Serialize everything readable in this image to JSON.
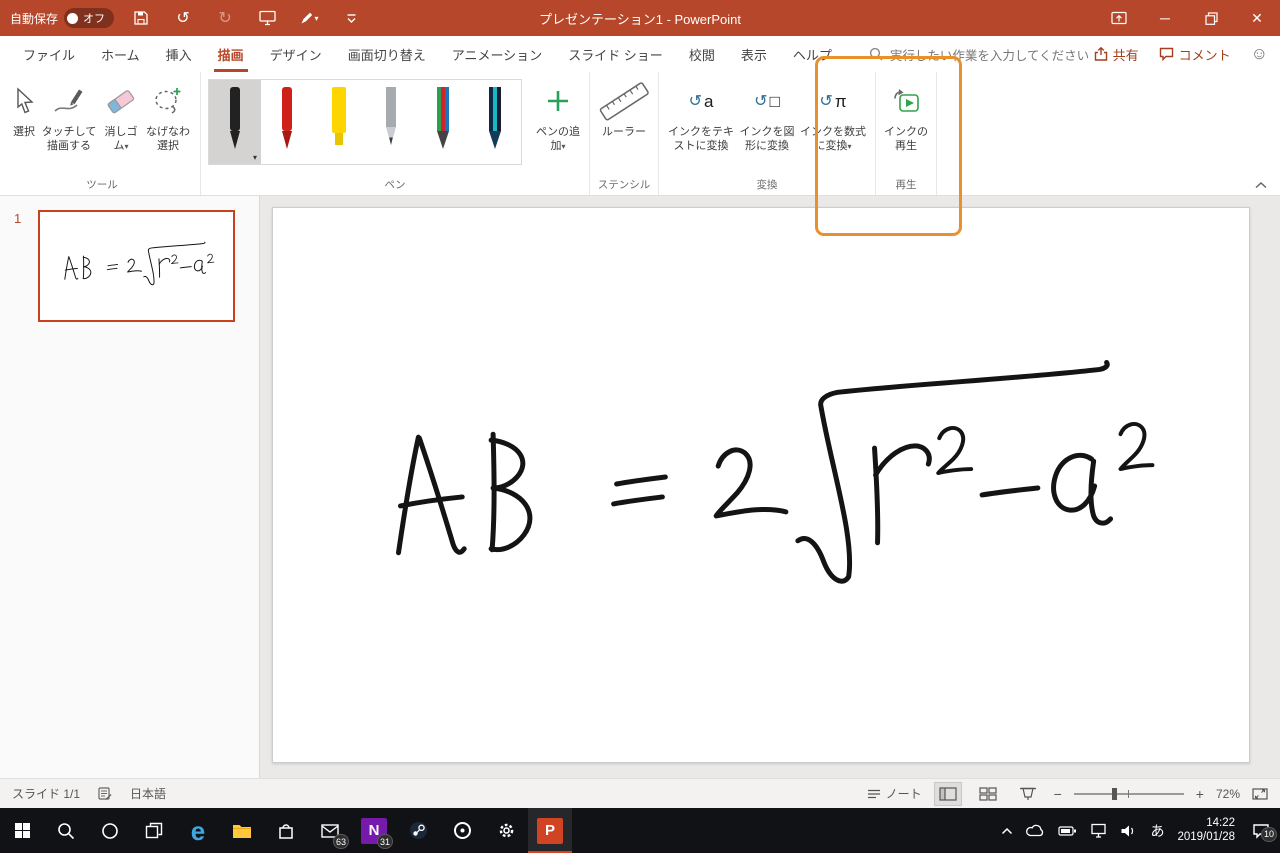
{
  "colors": {
    "accent": "#B7472A",
    "annotation_box": "#E8912C",
    "selection_border": "#C8401E",
    "powerpoint_orange": "#D04423"
  },
  "titlebar": {
    "autosave_label": "自動保存",
    "autosave_state": "オフ",
    "title": "プレゼンテーション1 - PowerPoint"
  },
  "tabs": {
    "file": "ファイル",
    "home": "ホーム",
    "insert": "挿入",
    "draw": "描画",
    "design": "デザイン",
    "transitions": "画面切り替え",
    "animations": "アニメーション",
    "slideshow": "スライド ショー",
    "review": "校閲",
    "view": "表示",
    "help": "ヘルプ"
  },
  "search": {
    "placeholder": "実行したい作業を入力してください"
  },
  "actions": {
    "share": "共有",
    "comments": "コメント"
  },
  "ribbon": {
    "tools": {
      "group": "ツール",
      "select": "選択",
      "draw_touch": "タッチして描画する",
      "eraser": "消しゴム",
      "lasso": "なげなわ選択"
    },
    "pens": {
      "group": "ペン",
      "add_pen": "ペンの追加"
    },
    "stencils": {
      "group": "ステンシル",
      "ruler": "ルーラー"
    },
    "convert": {
      "group": "変換",
      "ink_to_text": "インクをテキストに変換",
      "ink_to_shape": "インクを図形に変換",
      "ink_to_math": "インクを数式に変換"
    },
    "replay": {
      "group": "再生",
      "ink_replay": "インクの再生"
    }
  },
  "slide_panel": {
    "slide_number": "1"
  },
  "canvas": {
    "ink_formula": "AB = 2√r²−a²"
  },
  "statusbar": {
    "slide_indicator": "スライド 1/1",
    "language": "日本語",
    "notes": "ノート",
    "zoom_level": "72%"
  },
  "taskbar": {
    "ime_mode": "あ",
    "time": "14:22",
    "date": "2019/01/28",
    "mail_badge": "63",
    "onenote_badge": "31",
    "notification_badge": "10"
  },
  "icons": {
    "powerpoint_logo": "P",
    "onenote_logo": "N",
    "edge_logo": "e",
    "convert_text_glyph": "a",
    "convert_shape_glyph": "□",
    "convert_math_glyph": "π"
  }
}
